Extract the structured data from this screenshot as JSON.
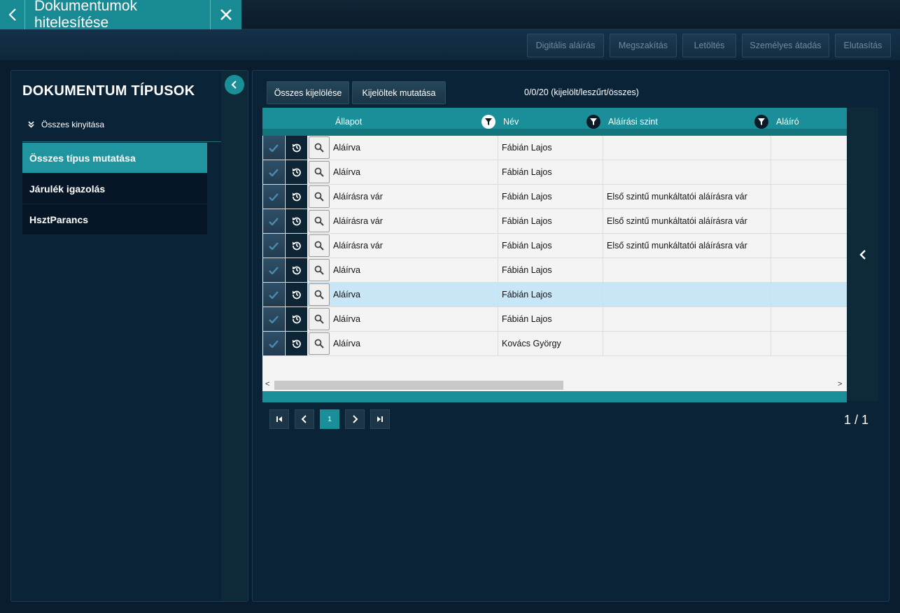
{
  "window": {
    "title": "Dokumentumok hitelesítése"
  },
  "toolbar": {
    "actions": [
      {
        "label": "Digitális aláírás"
      },
      {
        "label": "Megszakítás"
      },
      {
        "label": "Letöltés"
      },
      {
        "label": "Személyes átadás"
      },
      {
        "label": "Elutasítás"
      }
    ]
  },
  "sidebar": {
    "title": "DOKUMENTUM TÍPUSOK",
    "expand_all_label": "Összes kinyitása",
    "items": [
      {
        "label": "Összes típus mutatása",
        "active": true
      },
      {
        "label": "Járulék igazolás",
        "active": false
      },
      {
        "label": "HsztParancs",
        "active": false
      }
    ]
  },
  "main": {
    "select_all_label": "Összes kijelölése",
    "show_selected_label": "Kijelöltek mutatása",
    "count_text": "0/0/20 (kijelölt/leszűrt/összes)",
    "columns": [
      "Állapot",
      "Név",
      "Aláírási szint",
      "Aláíró"
    ],
    "rows": [
      {
        "status": "Aláírva",
        "name": "Fábián Lajos",
        "level": "",
        "signer": ""
      },
      {
        "status": "Aláírva",
        "name": "Fábián Lajos",
        "level": "",
        "signer": ""
      },
      {
        "status": "Aláírásra vár",
        "name": "Fábián Lajos",
        "level": "Első szintű munkáltatói aláírásra vár",
        "signer": ""
      },
      {
        "status": "Aláírásra vár",
        "name": "Fábián Lajos",
        "level": "Első szintű munkáltatói aláírásra vár",
        "signer": ""
      },
      {
        "status": "Aláírásra vár",
        "name": "Fábián Lajos",
        "level": "Első szintű munkáltatói aláírásra vár",
        "signer": ""
      },
      {
        "status": "Aláírva",
        "name": "Fábián Lajos",
        "level": "",
        "signer": ""
      },
      {
        "status": "Aláírva",
        "name": "Fábián Lajos",
        "level": "",
        "signer": "",
        "selected": true
      },
      {
        "status": "Aláírva",
        "name": "Fábián Lajos",
        "level": "",
        "signer": ""
      },
      {
        "status": "Aláírva",
        "name": "Kovács György",
        "level": "",
        "signer": ""
      }
    ],
    "pager": {
      "current_page": "1",
      "page_total": "1 / 1"
    }
  },
  "colors": {
    "accent": "#1a8f99",
    "selected_row": "#c8e6f5",
    "background": "#0a1d2e"
  },
  "icons": [
    "chevron-left-icon",
    "close-icon",
    "double-chevron-down-icon",
    "filter-icon",
    "check-icon",
    "history-icon",
    "search-icon",
    "first-page-icon",
    "prev-page-icon",
    "next-page-icon",
    "last-page-icon"
  ]
}
